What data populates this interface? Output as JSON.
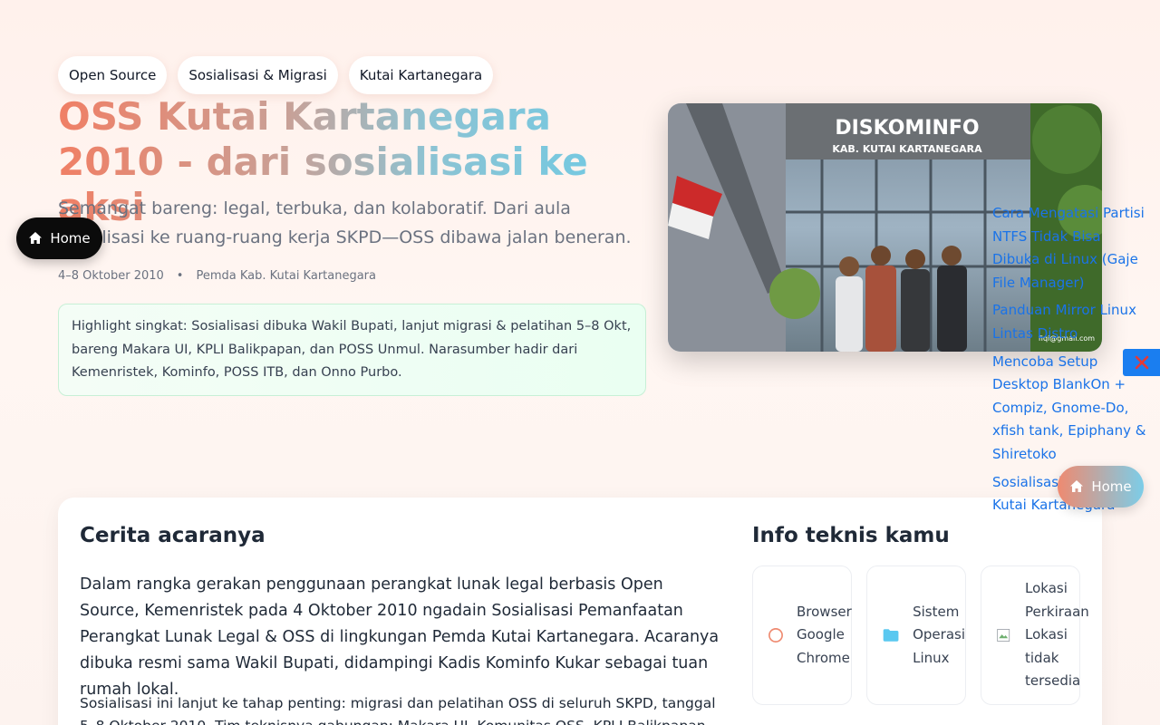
{
  "tags": [
    "Open Source",
    "Sosialisasi & Migrasi",
    "Kutai Kartanegara"
  ],
  "hero": {
    "title": "OSS Kutai Kartanegara 2010 - dari sosialisasi ke aksi",
    "subtitle": "Semangat bareng: legal, terbuka, dan kolaboratif. Dari aula sosialisasi ke ruang-ruang kerja SKPD—OSS dibawa jalan beneran.",
    "date": "4–8 Oktober 2010",
    "separator": "•",
    "org": "Pemda Kab. Kutai Kartanegara",
    "highlight": "Highlight singkat: Sosialisasi dibuka Wakil Bupati, lanjut migrasi & pelatihan 5–8 Okt, bareng Makara UI, KPLI Balikpapan, dan POSS Unmul. Narasumber hadir dari Kemenristek, Kominfo, POSS ITB, dan Onno Purbo."
  },
  "photo": {
    "sign_line1": "DISKOMINFO",
    "sign_line2": "KAB. KUTAI KARTANEGARA",
    "watermark": "fiqi@gmail.com"
  },
  "nav": {
    "home_label": "Home",
    "home_float_label": "Home"
  },
  "related": [
    "Cara Mengatasi Partisi NTFS Tidak Bisa Dibuka di Linux (Gaje File Manager)",
    "Panduan Mirror Linux Lintas Distro",
    "Mencoba Setup Desktop BlankOn + Compiz, Gnome-Do, xfish tank, Epiphany & Shiretoko",
    "Sosialisasi OSS di Kutai Kartanegara"
  ],
  "story": {
    "title": "Cerita acaranya",
    "p1": "Dalam rangka gerakan penggunaan perangkat lunak legal berbasis Open Source, Kemenristek pada 4 Oktober 2010 ngadain Sosialisasi Pemanfaatan Perangkat Lunak Legal & OSS di lingkungan Pemda Kutai Kartanegara. Acaranya dibuka resmi sama Wakil Bupati, didampingi Kadis Kominfo Kukar sebagai tuan rumah lokal.",
    "p2": "Sosialisasi ini lanjut ke tahap penting: migrasi dan pelatihan OSS di seluruh SKPD, tanggal 5–8 Oktober 2010. Tim teknisnya gabungan: Makara UI, Komunitas OSS, KPLI Balikpapan, dan POSS"
  },
  "info": {
    "title": "Info teknis kamu",
    "cards": [
      {
        "icon": "browser-circle-icon",
        "label": "Browser Google Chrome"
      },
      {
        "icon": "folder-icon",
        "label": "Sistem Operasi Linux"
      },
      {
        "icon": "broken-image-icon",
        "label": "Lokasi Perkiraan Lokasi tidak tersedia"
      }
    ]
  },
  "colors": {
    "accent_coral": "#f07f65",
    "accent_sky": "#6ccbe6",
    "link_blue": "#1a73e8",
    "close_blue": "#1a7ef0",
    "close_x": "#e53935"
  }
}
